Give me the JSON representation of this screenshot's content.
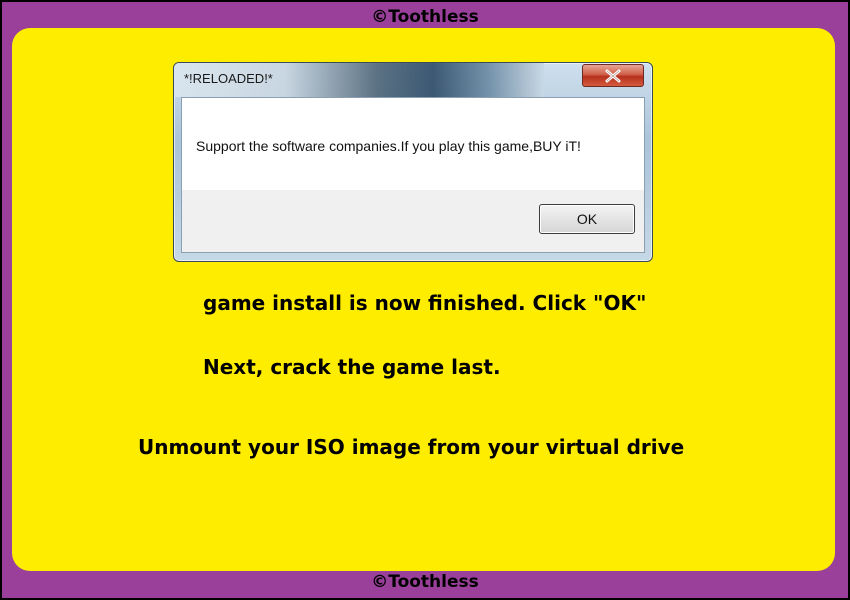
{
  "credit": {
    "top": "©Toothless",
    "bottom": "©Toothless"
  },
  "dialog": {
    "title": "*!RELOADED!*",
    "close_icon": "close-x-icon",
    "message": "Support the software companies.If you play this game,BUY iT!",
    "ok_label": "OK"
  },
  "instructions": {
    "line1": "game install is now finished.  Click \"OK\"",
    "line2": "Next, crack the game last.",
    "line3": "Unmount your ISO image from your virtual drive"
  },
  "colors": {
    "frame": "#9a409a",
    "panel": "#ffed00",
    "close_button": "#c8432b"
  }
}
